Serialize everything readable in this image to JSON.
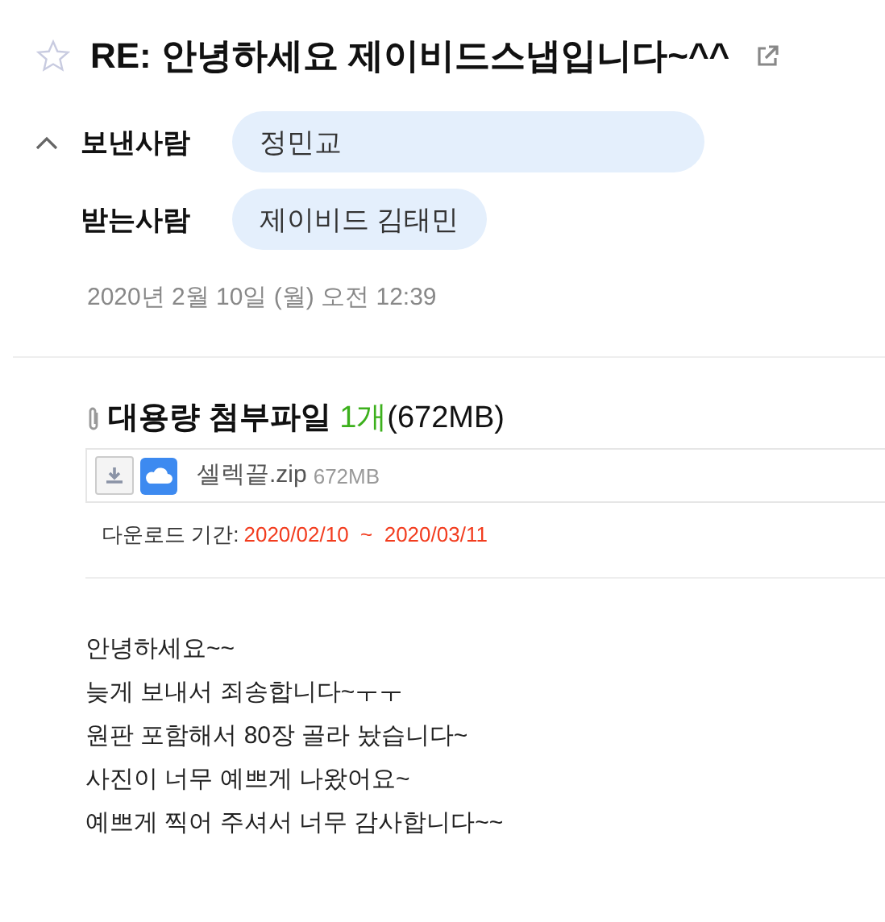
{
  "mail": {
    "starred": false,
    "subject": "RE: 안녕하세요 제이비드스냅입니다~^^",
    "headers_expanded": true,
    "headers": [
      {
        "label": "보낸사람",
        "value": "정민교"
      },
      {
        "label": "받는사람",
        "value": "제이비드 김태민"
      }
    ],
    "date": "2020년 2월 10일 (월) 오전 12:39"
  },
  "attachments": {
    "title": "대용량 첨부파일",
    "count": "1개",
    "total_size": "(672MB)",
    "files": [
      {
        "name": "셀렉끝.zip",
        "size": "672MB"
      }
    ],
    "period_label": "다운로드 기간:",
    "period": "2020/02/10  ~  2020/03/11"
  },
  "body": [
    "안녕하세요~~",
    "늦게 보내서 죄송합니다~ㅜㅜ",
    "원판 포함해서 80장 골라 놨습니다~",
    "사진이 너무 예쁘게 나왔어요~",
    "예쁘게 찍어 주셔서 너무 감사합니다~~"
  ]
}
